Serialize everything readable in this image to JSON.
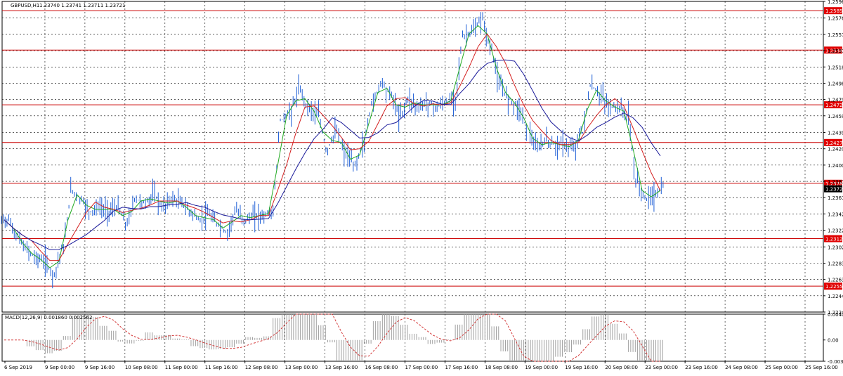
{
  "header": {
    "symbol_label": "GBPUSD,H1",
    "ohlc_text": "1.23740 1.23741 1.23711 1.23721"
  },
  "colors": {
    "background": "#ffffff",
    "grid": "#000000",
    "price_bar": "#1f5fd6",
    "ma_fast": "#22aa22",
    "ma_mid": "#d42020",
    "ma_slow": "#1a1a9a",
    "hline": "#cc0000",
    "hline_label_bg": "#e00000",
    "current_label_bg": "#000000",
    "macd_hist": "#a0a0a0",
    "macd_signal": "#d43a3a"
  },
  "chart_data": [
    {
      "type": "candlestick",
      "name": "price",
      "ylim": [
        1.22245,
        1.25965
      ],
      "y_ticks": [
        "1.25965",
        "1.25766",
        "1.25570",
        "1.25375",
        "1.25180",
        "1.24985",
        "1.24790",
        "1.24595",
        "1.24395",
        "1.24200",
        "1.24005",
        "1.23810",
        "1.23615",
        "1.23420",
        "1.23225",
        "1.23025",
        "1.22830",
        "1.22635",
        "1.22440",
        "1.22245"
      ],
      "x_ticks": [
        "6 Sep 2019",
        "9 Sep 00:00",
        "9 Sep 16:00",
        "10 Sep 08:00",
        "11 Sep 00:00",
        "11 Sep 16:00",
        "12 Sep 08:00",
        "13 Sep 00:00",
        "13 Sep 16:00",
        "16 Sep 08:00",
        "17 Sep 00:00",
        "17 Sep 16:00",
        "18 Sep 08:00",
        "19 Sep 00:00",
        "19 Sep 16:00",
        "20 Sep 08:00",
        "23 Sep 00:00",
        "23 Sep 16:00",
        "24 Sep 08:00",
        "25 Sep 00:00",
        "25 Sep 16:00"
      ],
      "horizontal_levels": [
        "1.25854",
        "1.25382",
        "1.24727",
        "1.24275",
        "1.23787",
        "1.23124",
        "1.22555"
      ],
      "current_price": "1.23721",
      "series_close_approx": [
        1.2335,
        1.2315,
        1.23,
        1.229,
        1.2285,
        1.227,
        1.23,
        1.237,
        1.236,
        1.2345,
        1.235,
        1.2345,
        1.235,
        1.233,
        1.236,
        1.2355,
        1.2365,
        1.235,
        1.236,
        1.2355,
        1.2345,
        1.2335,
        1.234,
        1.233,
        1.232,
        1.2345,
        1.2335,
        1.234,
        1.234,
        1.2345,
        1.2455,
        1.2465,
        1.249,
        1.247,
        1.246,
        1.242,
        1.244,
        1.2415,
        1.24,
        1.2425,
        1.2475,
        1.25,
        1.2485,
        1.246,
        1.248,
        1.247,
        1.2475,
        1.247,
        1.2475,
        1.248,
        1.2555,
        1.256,
        1.2575,
        1.254,
        1.2495,
        1.248,
        1.247,
        1.2445,
        1.242,
        1.243,
        1.2425,
        1.2425,
        1.242,
        1.244,
        1.2495,
        1.2485,
        1.247,
        1.247,
        1.246,
        1.238,
        1.236,
        1.2365,
        1.2375
      ]
    },
    {
      "type": "macd",
      "title": "MACD(12,26,9) 0.001860 0.002562",
      "y_ticks": [
        "0.004077",
        "0.00",
        "-0.00336"
      ],
      "ylim": [
        -0.00336,
        0.004077
      ],
      "signal": "dashed red line"
    }
  ]
}
